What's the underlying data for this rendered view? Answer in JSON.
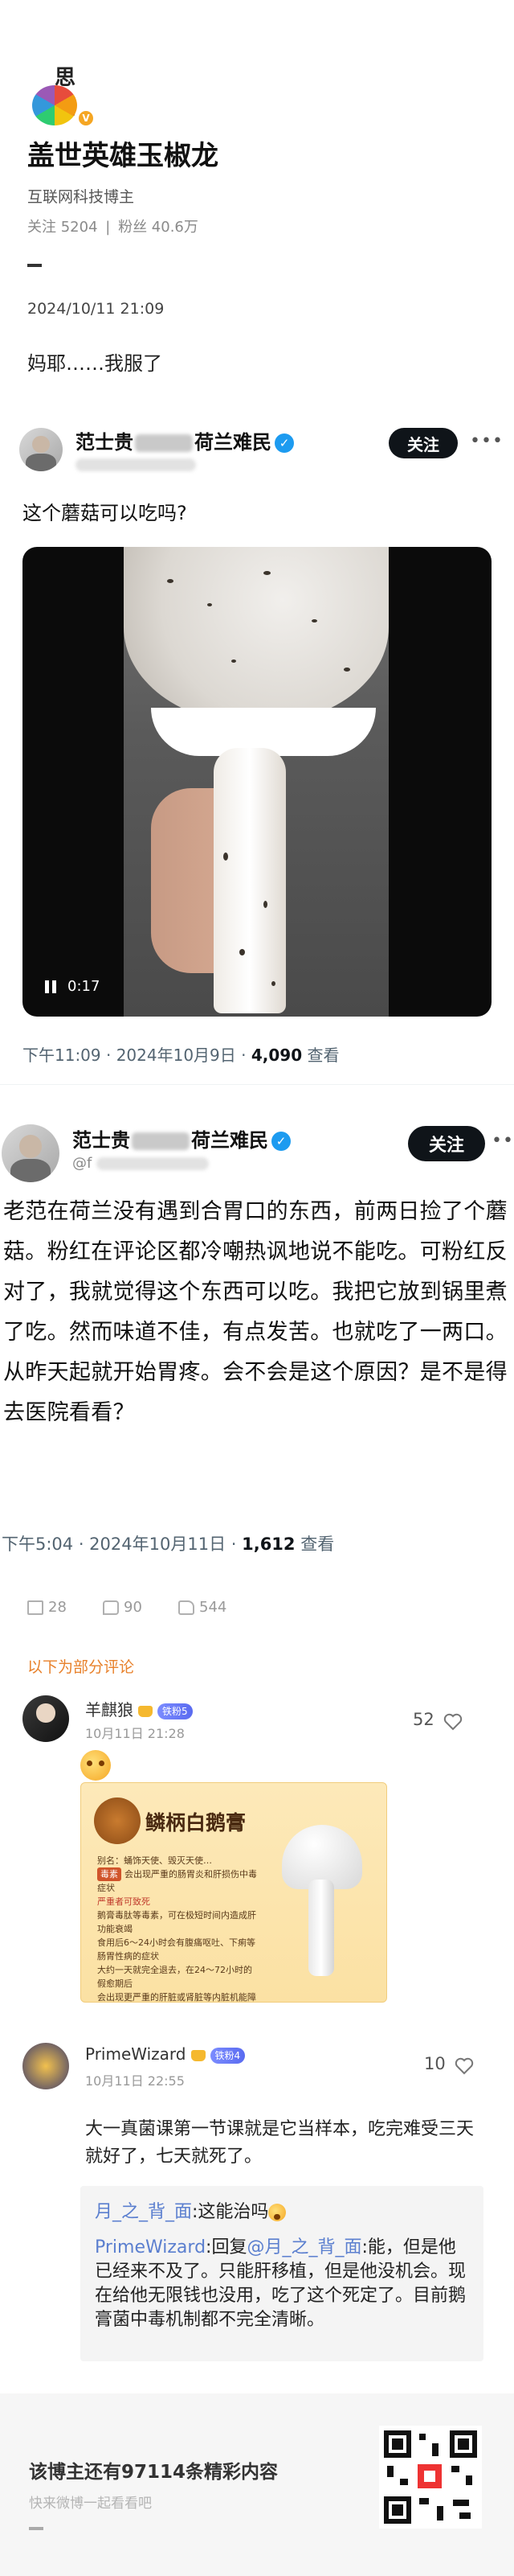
{
  "blogger": {
    "avatar_icon": "hand-drawn-avatar",
    "name": "盖世英雄玉椒龙",
    "description": "互联网科技博主",
    "following_label": "关注 5204",
    "separator": "|",
    "followers_label": "粉丝 40.6万"
  },
  "post": {
    "timestamp": "2024/10/11 21:09",
    "text": "妈耶……我服了"
  },
  "tweet1": {
    "name_left": "范士贵",
    "name_right": "荷兰难民",
    "follow_label": "关注",
    "more_label": "•••",
    "text": "这个蘑菇可以吃吗?",
    "video_time": "0:17",
    "meta_time": "下午11:09 · 2024年10月9日 · ",
    "views": "4,090",
    "views_label": " 查看"
  },
  "tweet2": {
    "name_left": "范士贵",
    "name_right": "荷兰难民",
    "handle_prefix": "@f",
    "follow_label": "关注",
    "more_label": "•••",
    "text": "老范在荷兰没有遇到合胃口的东西，前两日捡了个蘑菇。粉红在评论区都冷嘲热讽地说不能吃。可粉红反对了，我就觉得这个东西可以吃。我把它放到锅里煮了吃。然而味道不佳，有点发苦。也就吃了一两口。从昨天起就开始胃疼。会不会是这个原因？是不是得去医院看看？",
    "meta_time": "下午5:04 · 2024年10月11日 · ",
    "views": "1,612",
    "views_label": " 查看"
  },
  "actions": {
    "repost": "28",
    "comment": "90",
    "like": "544"
  },
  "comments_section_label": "以下为部分评论",
  "comment1": {
    "user": "羊麒狼",
    "badge": "铁粉5",
    "time": "10月11日 21:28",
    "likes": "52",
    "card": {
      "title": "鳞柄白鹅膏",
      "line1": "别名：蛹饰天使、毁灭天使…",
      "tag": "毒素",
      "line2": "会出现严重的肠胃炎和肝损伤中毒症状",
      "line3": "严重者可致死",
      "line4": "鹅膏毒肽等毒素，可在极短时间内造成肝功能衰竭",
      "line5": "食用后6～24小时会有腹痛呕吐、下痢等肠胃性病的症状",
      "line6": "大约一天就完全退去，在24～72小时的假愈期后",
      "line7": "会出现更严重的肝脏或肾脏等内脏机能障碍以至衰竭的症状"
    }
  },
  "comment2": {
    "user": "PrimeWizard",
    "badge": "铁粉4",
    "time": "10月11日 22:55",
    "likes": "10",
    "text": "大一真菌课第一节课就是它当样本，吃完难受三天就好了，七天就死了。",
    "reply1_user": "月_之_背_面",
    "reply1_text": ":这能治吗",
    "reply2_user": "PrimeWizard",
    "reply2_mid": ":回复",
    "reply2_target": "@月_之_背_面",
    "reply2_text": ":能，但是他已经来不及了。只能肝移植，但是他没机会。现在给他无限钱也没用，吃了这个死定了。目前鹅膏菌中毒机制都不完全清晰。"
  },
  "footer": {
    "title": "该博主还有97114条精彩内容",
    "subtitle": "快来微博一起看看吧"
  }
}
